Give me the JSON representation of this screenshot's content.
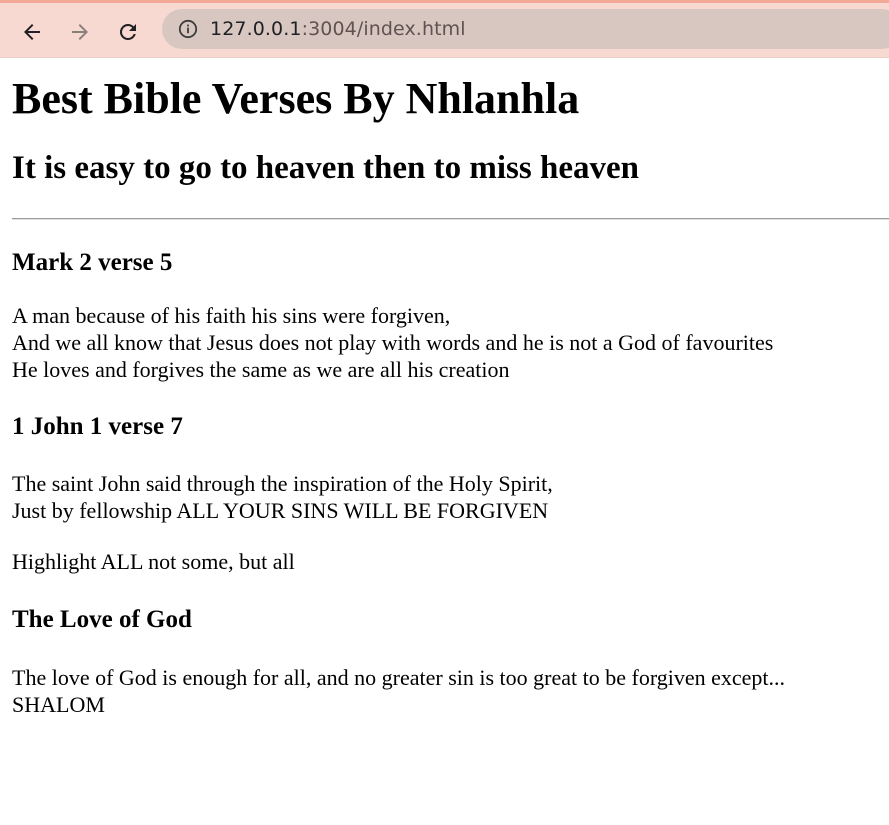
{
  "browser": {
    "url_host": "127.0.0.1",
    "url_path": ":3004/index.html",
    "icons": {
      "back": "arrow-left-icon",
      "forward": "arrow-right-icon",
      "reload": "reload-icon",
      "info": "info-icon"
    }
  },
  "page": {
    "title": "Best Bible Verses By Nhlanhla",
    "subtitle": "It is easy to go to heaven then to miss heaven",
    "sections": [
      {
        "heading": "Mark 2 verse 5",
        "lines": [
          "A man because of his faith his sins were forgiven,",
          "And we all know that Jesus does not play with words and he is not a God of favourites",
          "He loves and forgives the same as we are all his creation"
        ]
      },
      {
        "heading": "1 John 1 verse 7",
        "lines": [
          "The saint John said through the inspiration of the Holy Spirit,",
          "Just by fellowship ALL YOUR SINS WILL BE FORGIVEN"
        ],
        "note": "Highlight ALL not some, but all"
      },
      {
        "heading": "The Love of God",
        "lines": [
          "The love of God is enough for all, and no greater sin is too great to be forgiven except...",
          "SHALOM"
        ]
      }
    ]
  }
}
